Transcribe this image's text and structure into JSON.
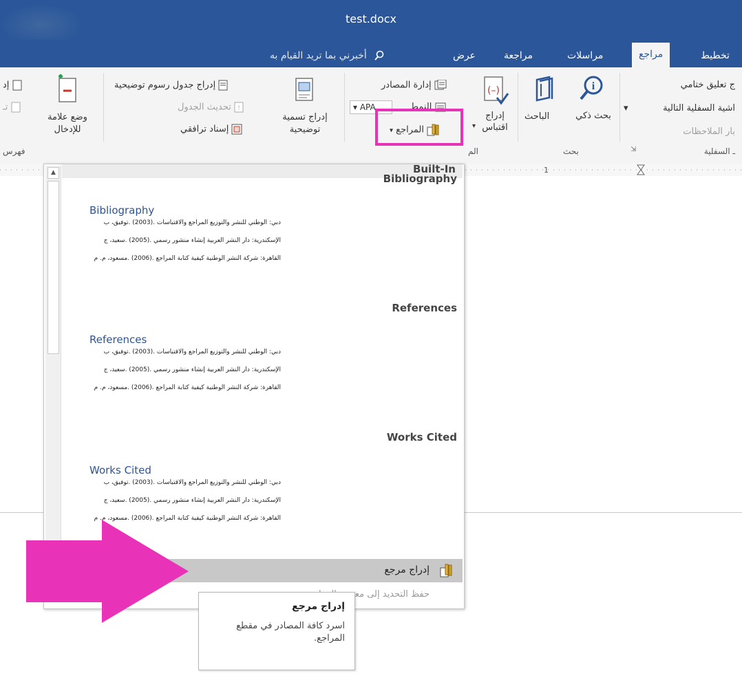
{
  "window": {
    "title": "test.docx"
  },
  "tabs": [
    {
      "label": "تخطيط",
      "active": false
    },
    {
      "label": "مراجع",
      "active": true
    },
    {
      "label": "مراسلات",
      "active": false
    },
    {
      "label": "مراجعة",
      "active": false
    },
    {
      "label": "عرض",
      "active": false
    }
  ],
  "tell_me": {
    "placeholder": "أخبرني بما تريد القيام به"
  },
  "ribbon": {
    "footnotes": {
      "insert_endnote": "ج تعليق ختامي",
      "next_footnote": "اشية السفلية التالية",
      "show_notes": "بار الملاحظات",
      "group_label": "ـ السفلية"
    },
    "research": {
      "smart_lookup": "بحث ذكي",
      "researcher": "الباحث",
      "group_label": "بحث"
    },
    "citations": {
      "insert_citation": "إدراج اقتباس",
      "manage_sources": "إدارة المصادر",
      "style_label": "النمط",
      "style_value": "APA",
      "bibliography": "المراجع",
      "group_label": "الم"
    },
    "captions": {
      "insert_caption": "إدراج تسمية توضيحية",
      "insert_table_of_figures": "إدراج جدول رسوم توضيحية",
      "update_table": "تحديث الجدول",
      "cross_reference": "إسناد ترافقي"
    },
    "index": {
      "mark_entry": "وضع علامة للإدخال",
      "insert_index": "إد",
      "update_index": "تـ",
      "group_label": "فهرس"
    }
  },
  "dropdown": {
    "header": "Built-In",
    "sections": [
      {
        "title": "Bibliography",
        "preview_title": "Bibliography",
        "lines": [
          "دبي: الوطني للنشر والتوزيع المراجع والاقتباسات .(2003) .توفيق، ب",
          "الإسكندرية: دار النشر العربية إنشاء منشور رسمي .(2005) .سعيد، ج",
          "القاهرة: شركة النشر الوطنية كيفية كتابة المراجع .(2006) .مسعود، م. م"
        ]
      },
      {
        "title": "References",
        "preview_title": "References",
        "lines": [
          "دبي: الوطني للنشر والتوزيع المراجع والاقتباسات .(2003) .توفيق، ب",
          "الإسكندرية: دار النشر العربية إنشاء منشور رسمي .(2005) .سعيد، ج",
          "القاهرة: شركة النشر الوطنية كيفية كتابة المراجع .(2006) .مسعود، م. م"
        ]
      },
      {
        "title": "Works Cited",
        "preview_title": "Works Cited",
        "lines": [
          "دبي: الوطني للنشر والتوزيع المراجع والاقتباسات .(2003) .توفيق، ب",
          "الإسكندرية: دار النشر العربية إنشاء منشور رسمي .(2005) .سعيد، ج",
          "القاهرة: شركة النشر الوطنية كيفية كتابة المراجع .(2006) .مسعود، م. م"
        ]
      }
    ],
    "insert_bibliography": "إدراج مرجع",
    "save_selection": "حفظ التحديد إلى معرض المراجع"
  },
  "tooltip": {
    "title": "إدراج مرجع",
    "body": "اسرد كافة المصادر في مقطع المراجع."
  },
  "colors": {
    "accent": "#2b579a",
    "highlight": "#e832b8"
  }
}
